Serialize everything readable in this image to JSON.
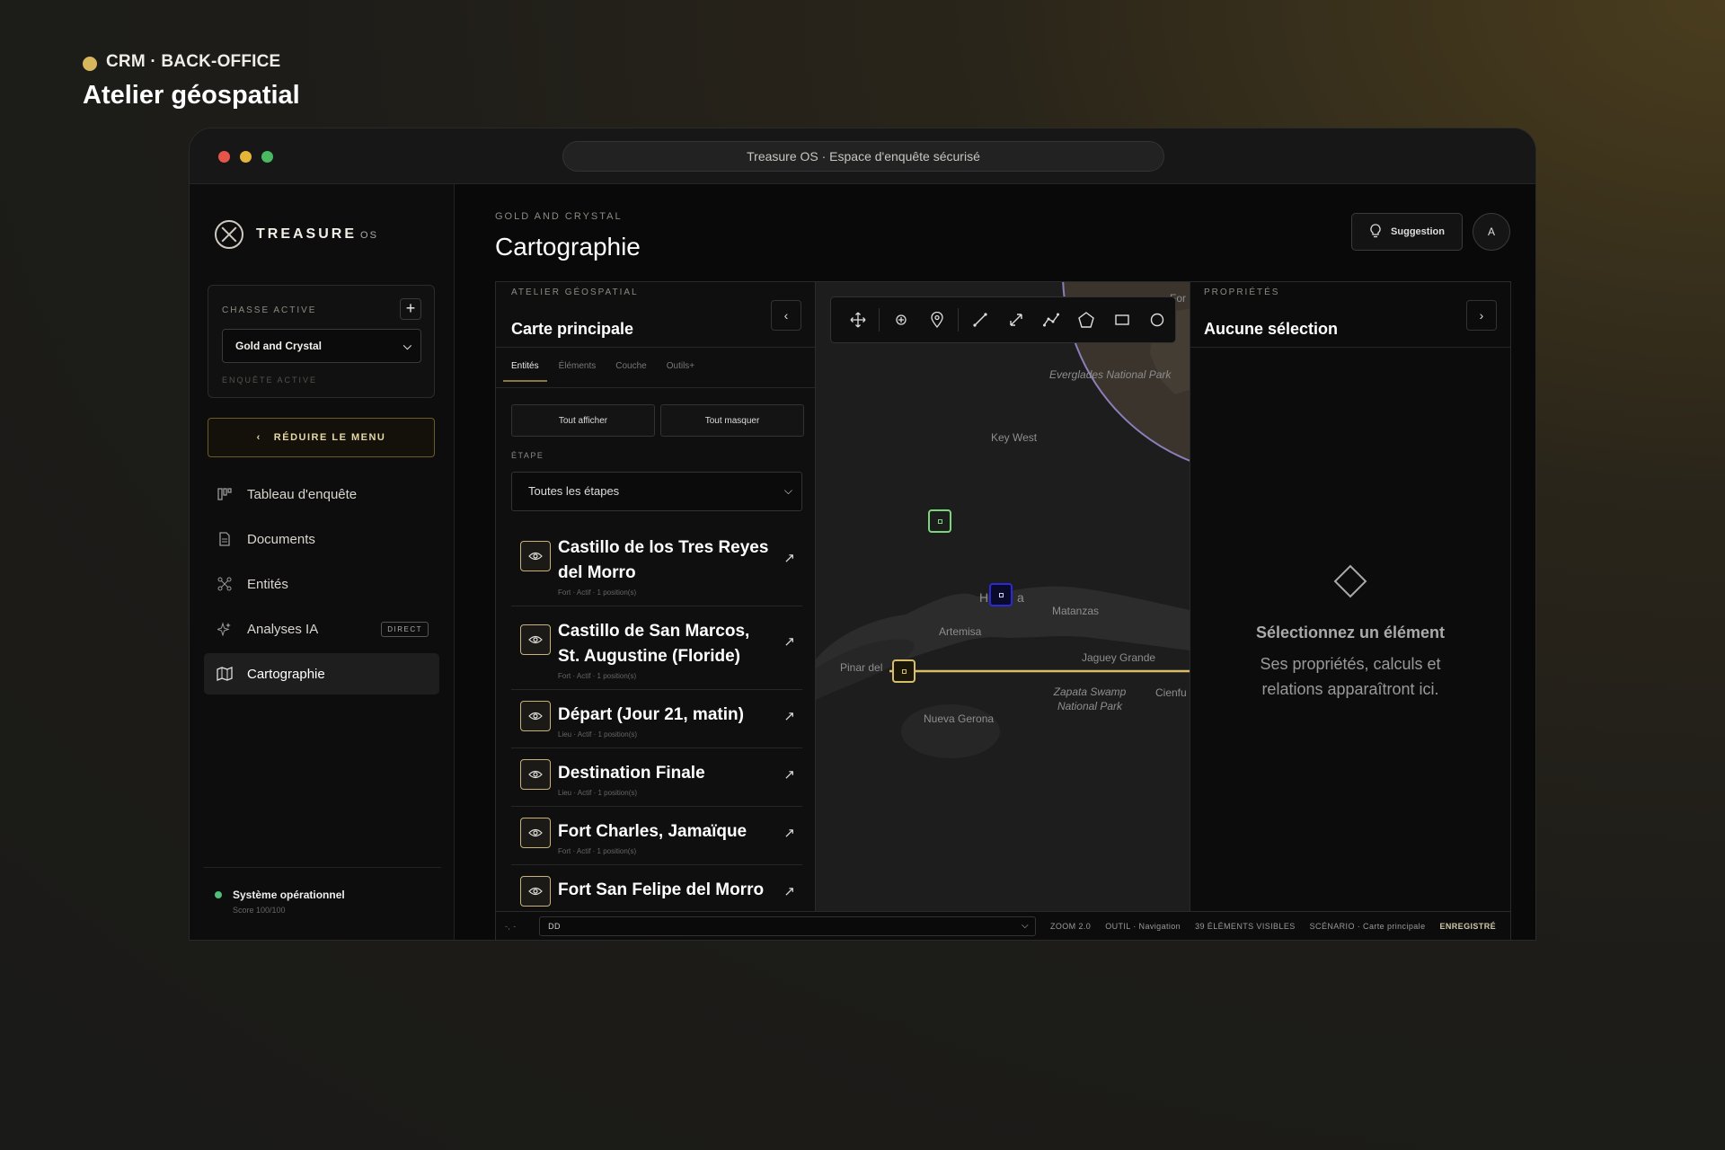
{
  "crm": {
    "kicker": "CRM · BACK-OFFICE",
    "title": "Atelier géospatial",
    "accent": "#d7b65e"
  },
  "window": {
    "address": "Treasure OS · Espace d'enquête sécurisé",
    "lights": [
      "#e5554a",
      "#e5b53a",
      "#48b960"
    ]
  },
  "sidebar": {
    "brand": {
      "name": "TREASURE",
      "suffix": "OS"
    },
    "hunt": {
      "label": "CHASSE ACTIVE",
      "add": "+",
      "selected": "Gold and Crystal",
      "sub": "ENQUÊTE ACTIVE"
    },
    "reduce_label": "RÉDUIRE LE MENU",
    "items": [
      {
        "label": "Tableau d'enquête",
        "icon": "board-icon"
      },
      {
        "label": "Documents",
        "icon": "document-icon"
      },
      {
        "label": "Entités",
        "icon": "network-icon"
      },
      {
        "label": "Analyses IA",
        "icon": "sparkle-icon",
        "badge": "DIRECT"
      },
      {
        "label": "Cartographie",
        "icon": "map-icon",
        "active": true
      }
    ],
    "status": {
      "label": "Système opérationnel",
      "score": "Score 100/100",
      "color": "#4fbf7a"
    }
  },
  "header": {
    "eyebrow": "GOLD AND CRYSTAL",
    "title": "Cartographie",
    "suggest_label": "Suggestion",
    "avatar": "A"
  },
  "left_panel": {
    "eyebrow": "ATELIER GÉOSPATIAL",
    "title": "Carte principale",
    "tabs": [
      "Entités",
      "Éléments",
      "Couche",
      "Outils+"
    ],
    "show_all": "Tout afficher",
    "hide_all": "Tout masquer",
    "etape_label": "ÉTAPE",
    "etape_value": "Toutes les étapes",
    "entities": [
      {
        "name": "Castillo de los Tres Reyes del Morro",
        "meta": "Fort · Actif · 1 position(s)"
      },
      {
        "name": "Castillo de San Marcos, St. Augustine (Floride)",
        "meta": "Fort · Actif · 1 position(s)"
      },
      {
        "name": "Départ (Jour 21, matin)",
        "meta": "Lieu · Actif · 1 position(s)"
      },
      {
        "name": "Destination Finale",
        "meta": "Lieu · Actif · 1 position(s)"
      },
      {
        "name": "Fort Charles, Jamaïque",
        "meta": "Fort · Actif · 1 position(s)"
      },
      {
        "name": "Fort San Felipe del Morro",
        "meta": ""
      }
    ]
  },
  "map": {
    "tools": [
      "move-icon",
      "crosshair-icon",
      "pin-icon",
      "line-icon",
      "measure-icon",
      "polyline-icon",
      "polygon-icon",
      "rectangle-icon",
      "circle-icon"
    ],
    "labels": [
      {
        "text": "Everglades National Park",
        "italic": true
      },
      {
        "text": "Key West",
        "italic": false
      },
      {
        "text": "Matanzas",
        "italic": false
      },
      {
        "text": "Artemisa",
        "italic": false
      },
      {
        "text": "Jaguey Grande",
        "italic": false
      },
      {
        "text": "Pinar del",
        "italic": false
      },
      {
        "text": "Zapata Swamp National Park",
        "italic": true
      },
      {
        "text": "Cienfu",
        "italic": false
      },
      {
        "text": "Nueva Gerona",
        "italic": false
      },
      {
        "text": "H",
        "italic": false
      },
      {
        "text": "a",
        "italic": false
      },
      {
        "text": "For",
        "italic": false
      }
    ],
    "colors": {
      "land": "#2a2a2a",
      "sea": "#1d1d1d",
      "route": "#d8bd6a",
      "zone": "#8c7eb8",
      "marker_green": "#7bd67b",
      "marker_blue": "#2a2ad8",
      "marker_gold": "#d8bd6a"
    }
  },
  "right_panel": {
    "eyebrow": "PROPRIÉTÉS",
    "title": "Aucune sélection",
    "empty_title": "Sélectionnez un élément",
    "empty_desc_1": "Ses propriétés, calculs et",
    "empty_desc_2": "relations apparaîtront ici."
  },
  "statusbar": {
    "coords": "-, -",
    "format": "DD",
    "zoom": "ZOOM 2.0",
    "tool": "OUTIL · Navigation",
    "visible": "39 ÉLÉMENTS VISIBLES",
    "scenario": "SCÉNARIO · Carte principale",
    "saved": "ENREGISTRÉ"
  }
}
